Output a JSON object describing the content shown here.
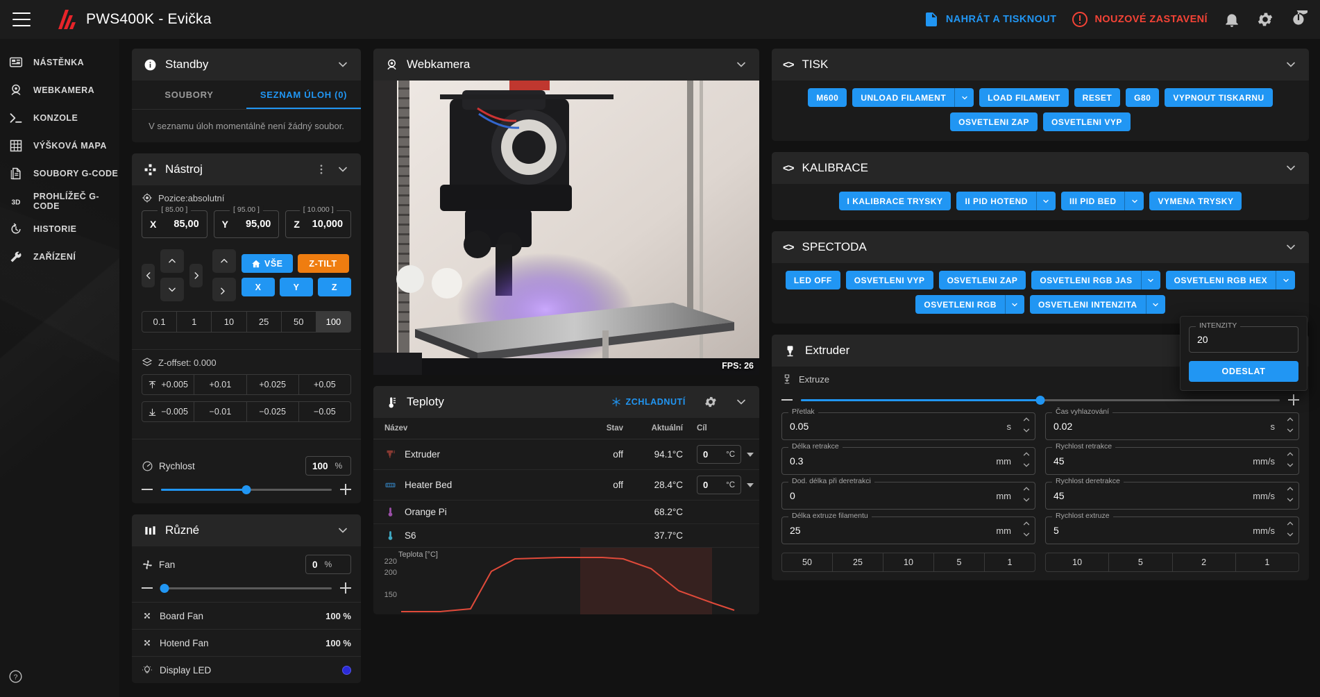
{
  "topbar": {
    "title": "PWS400K - Evička",
    "upload_label": "NAHRÁT A TISKNOUT",
    "estop_label": "NOUZOVÉ ZASTAVENÍ"
  },
  "sidebar": {
    "items": [
      {
        "label": "NÁSTĚNKA",
        "icon": "dashboard-icon"
      },
      {
        "label": "WEBKAMERA",
        "icon": "webcam-icon"
      },
      {
        "label": "KONZOLE",
        "icon": "console-icon"
      },
      {
        "label": "VÝŠKOVÁ MAPA",
        "icon": "heightmap-icon"
      },
      {
        "label": "SOUBORY G-CODE",
        "icon": "file-icon"
      },
      {
        "label": "PROHLÍŽEČ G-CODE",
        "icon": "3d-icon"
      },
      {
        "label": "HISTORIE",
        "icon": "history-icon"
      },
      {
        "label": "ZAŘÍZENÍ",
        "icon": "wrench-icon"
      }
    ],
    "help_icon": "help-icon"
  },
  "status_card": {
    "title": "Standby",
    "tabs": [
      {
        "label": "SOUBORY",
        "active": false
      },
      {
        "label": "SEZNAM ÚLOH (0)",
        "active": true
      }
    ],
    "empty_message": "V seznamu úloh momentálně není žádný soubor."
  },
  "tool": {
    "title": "Nástroj",
    "position_label": "Pozice:absolutní",
    "axes": [
      {
        "name": "X",
        "cap": "[ 85.00 ]",
        "value": "85,00"
      },
      {
        "name": "Y",
        "cap": "[ 95.00 ]",
        "value": "95,00"
      },
      {
        "name": "Z",
        "cap": "[ 10.000 ]",
        "value": "10,000"
      }
    ],
    "home_all_label": "VŠE",
    "ztilt_label": "Z-TILT",
    "home_x": "X",
    "home_y": "Y",
    "home_z": "Z",
    "steps": [
      "0.1",
      "1",
      "10",
      "25",
      "50",
      "100"
    ],
    "active_step": "100",
    "zoffset_label": "Z-offset: 0.000",
    "zoffset_up": [
      "+0.005",
      "+0.01",
      "+0.025",
      "+0.05"
    ],
    "zoffset_down": [
      "−0.005",
      "−0.01",
      "−0.025",
      "−0.05"
    ],
    "speed_label": "Rychlost",
    "speed_value": "100",
    "speed_unit": "%",
    "speed_pct": 50
  },
  "misc": {
    "title": "Různé",
    "fan_label": "Fan",
    "fan_value": "0",
    "fan_unit": "%",
    "fan_pct": 2,
    "rows": [
      {
        "label": "Board Fan",
        "value": "100 %",
        "icon": "fan-icon"
      },
      {
        "label": "Hotend Fan",
        "value": "100 %",
        "icon": "fan-icon"
      },
      {
        "label": "Display LED",
        "value": "",
        "icon": "bulb-icon"
      }
    ]
  },
  "webcam": {
    "title": "Webkamera",
    "fps": "FPS: 26"
  },
  "temps": {
    "title": "Teploty",
    "cooldown_label": "ZCHLADNUTÍ",
    "columns": [
      "Název",
      "Stav",
      "Aktuální",
      "Cíl"
    ],
    "rows": [
      {
        "name": "Extruder",
        "state": "off",
        "current": "94.1°C",
        "target": "0",
        "unit": "°C",
        "has_target": true,
        "icon": "extruder-icon",
        "color": "#8a3a32"
      },
      {
        "name": "Heater Bed",
        "state": "off",
        "current": "28.4°C",
        "target": "0",
        "unit": "°C",
        "has_target": true,
        "icon": "bed-icon",
        "color": "#2f6b9a"
      },
      {
        "name": "Orange Pi",
        "state": "",
        "current": "68.2°C",
        "target": "",
        "unit": "",
        "has_target": false,
        "icon": "thermo-icon",
        "color": "#9b4fa8"
      },
      {
        "name": "S6",
        "state": "",
        "current": "37.7°C",
        "target": "",
        "unit": "",
        "has_target": false,
        "icon": "thermo-icon",
        "color": "#3fa8c2"
      }
    ]
  },
  "chart_data": {
    "type": "line",
    "title": "Teplota [°C]",
    "ylabel": "Teplota [°C]",
    "xlabel": "",
    "yticks": [
      "220",
      "200",
      "150"
    ],
    "ylim": [
      0,
      240
    ],
    "grid": false,
    "series": [
      {
        "name": "Extruder",
        "color": "#e04a3a",
        "x": [
          0,
          10,
          18,
          24,
          30,
          42,
          52,
          58,
          66,
          78,
          90,
          100
        ],
        "y": [
          8,
          8,
          12,
          150,
          215,
          218,
          218,
          217,
          200,
          150,
          95,
          60
        ]
      }
    ],
    "highlight_band": {
      "from": 24,
      "to": 58,
      "color": "rgba(180,60,50,0.18)"
    }
  },
  "print_panel": {
    "title": "TISK",
    "buttons": [
      {
        "label": "M600",
        "split": false
      },
      {
        "label": "UNLOAD FILAMENT",
        "split": true
      },
      {
        "label": "LOAD FILAMENT",
        "split": false
      },
      {
        "label": "RESET",
        "split": false
      },
      {
        "label": "G80",
        "split": false
      },
      {
        "label": "VYPNOUT TISKARNU",
        "split": false
      },
      {
        "label": "OSVETLENI ZAP",
        "split": false
      },
      {
        "label": "OSVETLENI VYP",
        "split": false
      }
    ]
  },
  "calib_panel": {
    "title": "KALIBRACE",
    "buttons": [
      {
        "label": "I KALIBRACE TRYSKY",
        "split": false
      },
      {
        "label": "II PID HOTEND",
        "split": true
      },
      {
        "label": "III PID BED",
        "split": true
      },
      {
        "label": "VYMENA TRYSKY",
        "split": false
      }
    ]
  },
  "spectoda_panel": {
    "title": "SPECTODA",
    "buttons": [
      {
        "label": "LED OFF",
        "split": false
      },
      {
        "label": "OSVETLENI VYP",
        "split": false
      },
      {
        "label": "OSVETLENI ZAP",
        "split": false
      },
      {
        "label": "OSVETLENI RGB JAS",
        "split": true
      },
      {
        "label": "OSVETLENI RGB HEX",
        "split": true
      },
      {
        "label": "OSVETLENI RGB",
        "split": true
      },
      {
        "label": "OSVETLENI INTENZITA",
        "split": true
      }
    ]
  },
  "popup": {
    "label": "INTENZITY",
    "value": "20",
    "submit_label": "ODESLAT"
  },
  "extruder": {
    "title": "Extruder",
    "extrude_label": "Extruze",
    "extrude_pct": 50,
    "fields": [
      {
        "cap": "Přetlak",
        "value": "0.05",
        "unit": "s"
      },
      {
        "cap": "Čas vyhlazování",
        "value": "0.02",
        "unit": "s"
      },
      {
        "cap": "Délka retrakce",
        "value": "0.3",
        "unit": "mm"
      },
      {
        "cap": "Rychlost retrakce",
        "value": "45",
        "unit": "mm/s"
      },
      {
        "cap": "Dod. délka při deretrakci",
        "value": "0",
        "unit": "mm"
      },
      {
        "cap": "Rychlost deretrakce",
        "value": "45",
        "unit": "mm/s"
      },
      {
        "cap": "Délka extruze filamentu",
        "value": "25",
        "unit": "mm"
      },
      {
        "cap": "Rychlost extruze",
        "value": "5",
        "unit": "mm/s"
      }
    ],
    "steps_left": [
      "50",
      "25",
      "10",
      "5",
      "1"
    ],
    "steps_right": [
      "10",
      "5",
      "2",
      "1"
    ]
  },
  "colors": {
    "accent": "#2196f3",
    "danger": "#f44336",
    "warn": "#ef7d10",
    "bg": "#121212",
    "card": "#1b1b1b",
    "card_head": "#262626"
  }
}
